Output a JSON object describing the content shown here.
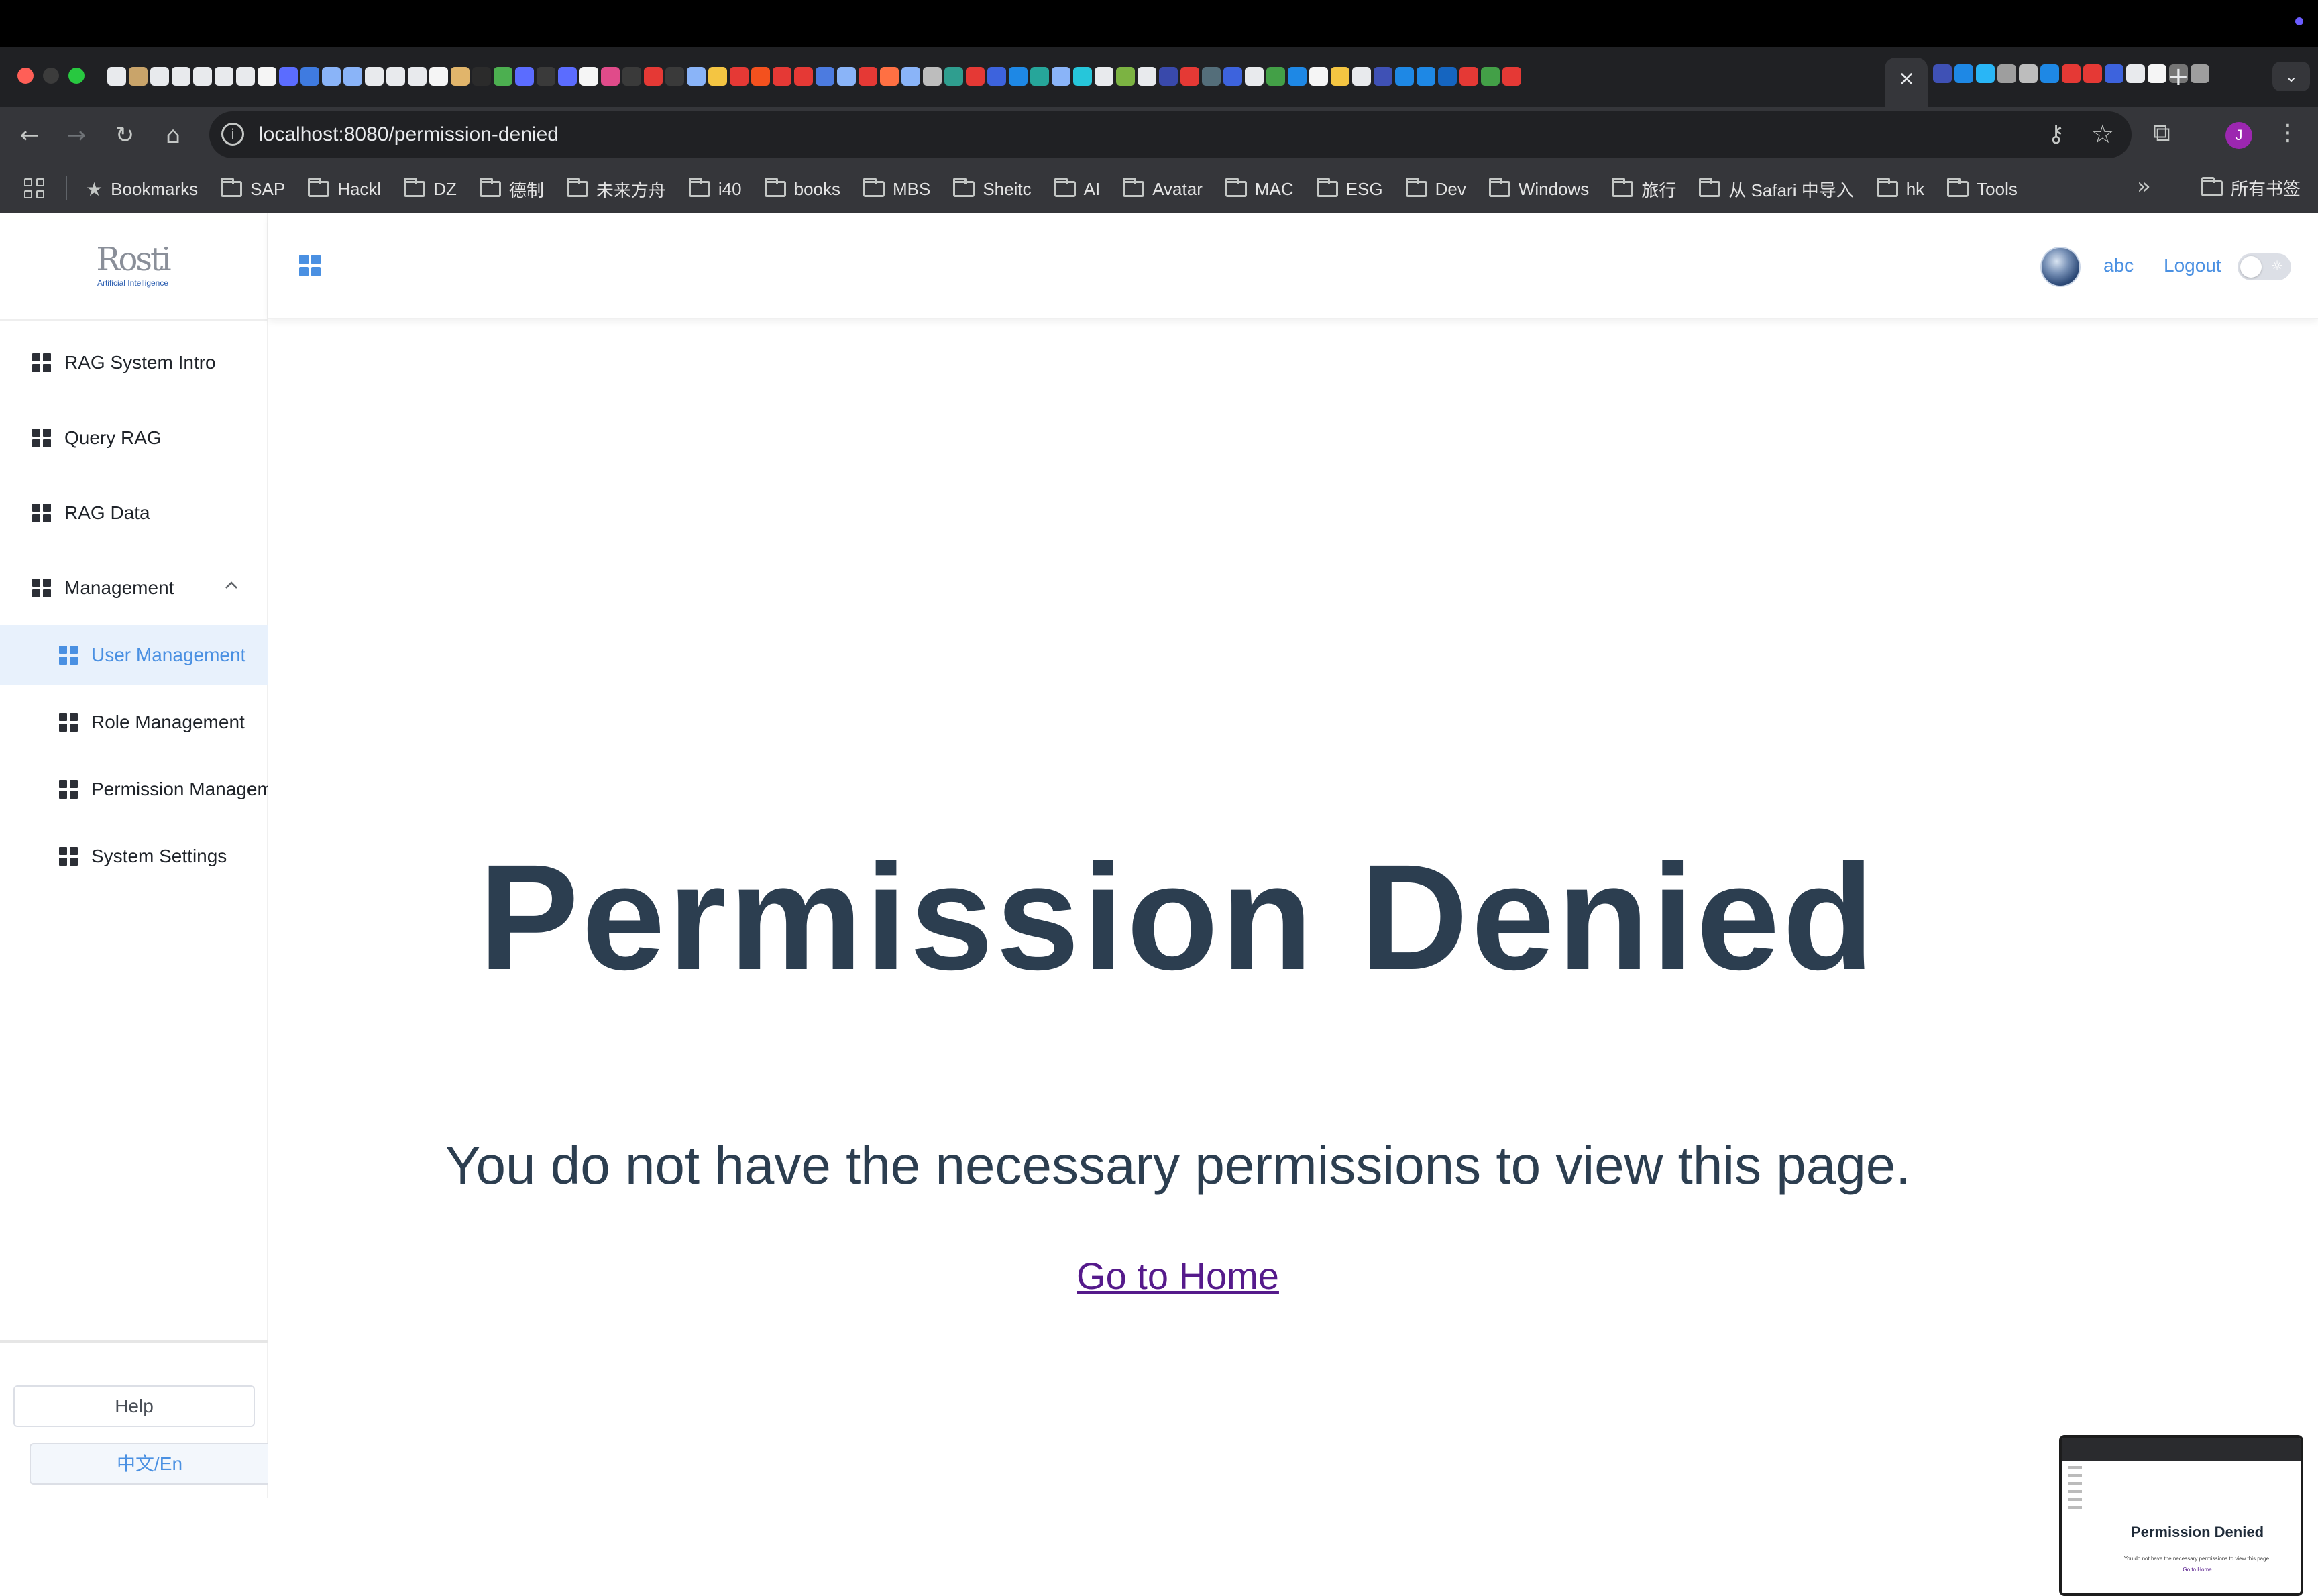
{
  "browser": {
    "url": "localhost:8080/permission-denied",
    "tab_close": "×",
    "new_tab": "+",
    "profile_initial": "J",
    "bookmarks": [
      {
        "label": "Bookmarks",
        "icon": "star-icon"
      },
      {
        "label": "SAP",
        "icon": "folder-icon"
      },
      {
        "label": "Hackl",
        "icon": "folder-icon"
      },
      {
        "label": "DZ",
        "icon": "folder-icon"
      },
      {
        "label": "德制",
        "icon": "folder-icon"
      },
      {
        "label": "未来方舟",
        "icon": "folder-icon"
      },
      {
        "label": "i40",
        "icon": "folder-icon"
      },
      {
        "label": "books",
        "icon": "folder-icon"
      },
      {
        "label": "MBS",
        "icon": "folder-icon"
      },
      {
        "label": "Sheitc",
        "icon": "folder-icon"
      },
      {
        "label": "AI",
        "icon": "folder-icon"
      },
      {
        "label": "Avatar",
        "icon": "folder-icon"
      },
      {
        "label": "MAC",
        "icon": "folder-icon"
      },
      {
        "label": "ESG",
        "icon": "folder-icon"
      },
      {
        "label": "Dev",
        "icon": "folder-icon"
      },
      {
        "label": "Windows",
        "icon": "folder-icon"
      },
      {
        "label": "旅行",
        "icon": "folder-icon"
      },
      {
        "label": "从 Safari 中导入",
        "icon": "folder-icon"
      },
      {
        "label": "hk",
        "icon": "folder-icon"
      },
      {
        "label": "Tools",
        "icon": "folder-icon"
      }
    ],
    "bookmarks_more": "»",
    "all_bookmarks": "所有书签"
  },
  "app": {
    "logo_text": "Rosti",
    "logo_tagline": "Artificial Intelligence",
    "sidebar": {
      "items": [
        {
          "label": "RAG System Intro"
        },
        {
          "label": "Query RAG"
        },
        {
          "label": "RAG Data"
        },
        {
          "label": "Management"
        }
      ],
      "management_children": [
        {
          "label": "User Management",
          "active": true
        },
        {
          "label": "Role Management"
        },
        {
          "label": "Permission Managem"
        },
        {
          "label": "System Settings"
        }
      ],
      "help_label": "Help",
      "lang_label": "中文/En"
    },
    "header": {
      "username": "abc",
      "logout_label": "Logout"
    },
    "main": {
      "title": "Permission Denied",
      "message": "You do not have the necessary permissions to view this page.",
      "home_link": "Go to Home"
    }
  },
  "colors": {
    "accent": "#4a90e2",
    "title_text": "#2c3e50",
    "link_visited": "#551a8b",
    "active_menu_bg": "#e8f1fc",
    "browser_toolbar": "#35363a"
  }
}
